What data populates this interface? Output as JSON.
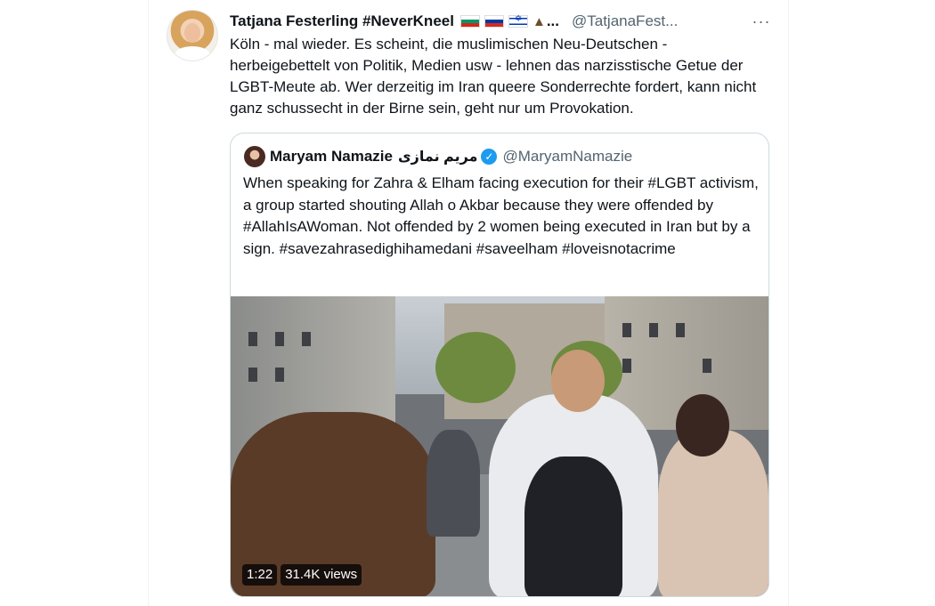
{
  "tweet": {
    "author_name": "Tatjana Festerling #NeverKneel",
    "author_flags": [
      "bulgaria-flag",
      "russia-flag",
      "israel-flag",
      "volcano-emoji"
    ],
    "name_truncation": "...",
    "handle": "@TatjanaFest...",
    "more_icon": "···",
    "text": "Köln - mal wieder. Es scheint, die muslimischen Neu-Deutschen - herbeigebettelt von Politik, Medien usw - lehnen das narzisstische Getue der LGBT-Meute ab. Wer derzeitig im Iran queere Sonderrechte fordert, kann nicht ganz schussecht in der Birne sein, geht nur um Provokation."
  },
  "quote": {
    "author_name": "Maryam Namazie",
    "author_name_arabic": "مریم نمازی",
    "verified_mark": "✓",
    "handle": "@MaryamNamazie",
    "text": "When speaking for Zahra & Elham facing execution for their #LGBT activism, a group started shouting Allah o Akbar because they were offended by #AllahIsAWoman. Not offended by 2 women being executed in Iran but by a sign. #savezahrasedighihamedani #saveelham #loveisnotacrime",
    "video": {
      "duration": "1:22",
      "views": "31.4K views"
    }
  },
  "colors": {
    "text_primary": "#0f1419",
    "text_secondary": "#536471",
    "border": "#cfd9de",
    "verified_blue": "#1d9bf0"
  }
}
